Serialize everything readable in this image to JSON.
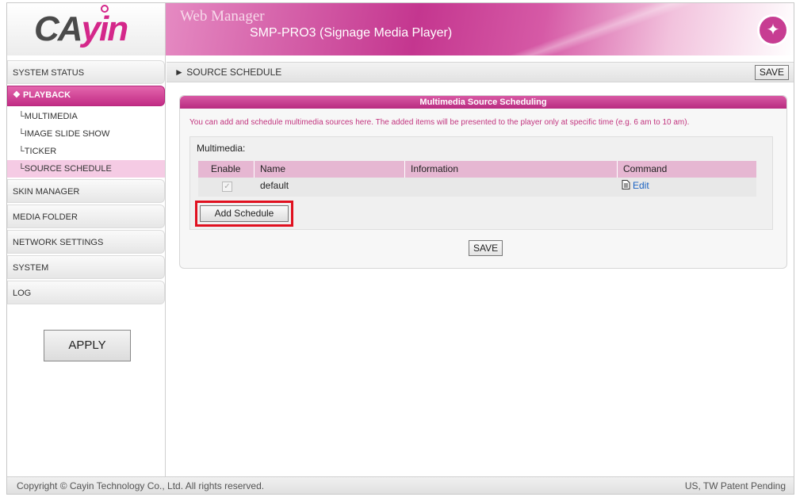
{
  "header": {
    "logo_main": "CA",
    "logo_accent": "yin",
    "app_title": "Web Manager",
    "device_title": "SMP-PRO3 (Signage Media Player)"
  },
  "sidebar": {
    "items": [
      {
        "label": "SYSTEM STATUS"
      },
      {
        "label": "PLAYBACK",
        "marker": "❖"
      },
      {
        "label": "SKIN MANAGER"
      },
      {
        "label": "MEDIA FOLDER"
      },
      {
        "label": "NETWORK SETTINGS"
      },
      {
        "label": "SYSTEM"
      },
      {
        "label": "LOG"
      }
    ],
    "playback_sub": [
      {
        "label": "MULTIMEDIA"
      },
      {
        "label": "IMAGE SLIDE SHOW"
      },
      {
        "label": "TICKER"
      },
      {
        "label": "SOURCE SCHEDULE"
      }
    ],
    "sub_prefix": "└",
    "apply_label": "APPLY"
  },
  "breadcrumb": {
    "arrow": "►",
    "title": "SOURCE SCHEDULE",
    "save_label": "SAVE"
  },
  "panel": {
    "title": "Multimedia Source Scheduling",
    "note": "You can add and schedule multimedia sources here. The added items will be presented to the player only at specific time (e.g. 6 am to 10 am).",
    "section_label": "Multimedia:",
    "columns": [
      "Enable",
      "Name",
      "Information",
      "Command"
    ],
    "row": {
      "enabled_mark": "✓",
      "name": "default",
      "information": "",
      "command_icon": "document-icon",
      "command_label": "Edit"
    },
    "add_label": "Add Schedule",
    "save_label": "SAVE"
  },
  "footer": {
    "copyright": "Copyright © Cayin Technology Co., Ltd. All rights reserved.",
    "patent": "US, TW Patent Pending"
  },
  "colors": {
    "brand_magenta": "#c22c85",
    "highlight_red": "#e0101f",
    "note_text": "#c2357f",
    "link_blue": "#1a62c2"
  }
}
